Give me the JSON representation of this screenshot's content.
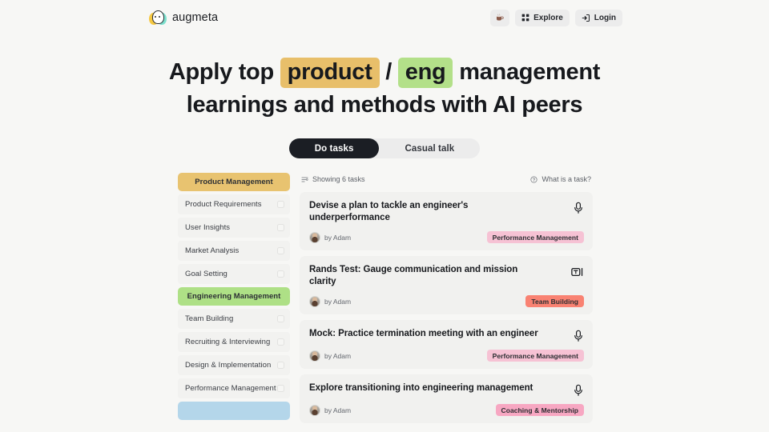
{
  "brand": {
    "name": "augmeta",
    "logo_icon": "augmeta-mascot-icon"
  },
  "topbar": {
    "coffee_button": {
      "icon": "coffee-cup-icon",
      "label": ""
    },
    "explore_button": {
      "icon": "grid-icon",
      "label": "Explore"
    },
    "login_button": {
      "icon": "login-arrow-icon",
      "label": "Login"
    }
  },
  "hero": {
    "line1_pre": "Apply top",
    "highlight_product": "product",
    "separator": "/",
    "highlight_eng": "eng",
    "line1_post": "management",
    "line2": "learnings and methods with AI peers",
    "product_color": "#e8bf6a",
    "eng_color": "#b3e089"
  },
  "mode_toggle": {
    "options": [
      "Do tasks",
      "Casual talk"
    ],
    "active": "Do tasks"
  },
  "sidebar": {
    "groups": [
      {
        "header": "Product Management",
        "color": "#e8c370",
        "items": [
          {
            "label": "Product Requirements",
            "checked": false
          },
          {
            "label": "User Insights",
            "checked": false
          },
          {
            "label": "Market Analysis",
            "checked": false
          },
          {
            "label": "Goal Setting",
            "checked": false
          }
        ]
      },
      {
        "header": "Engineering Management",
        "color": "#aee086",
        "items": [
          {
            "label": "Team Building",
            "checked": false
          },
          {
            "label": "Recruiting & Interviewing",
            "checked": false
          },
          {
            "label": "Design & Implementation",
            "checked": false
          },
          {
            "label": "Performance Management",
            "checked": false
          }
        ]
      },
      {
        "header": "",
        "color": "#b4d6ea",
        "items": []
      }
    ]
  },
  "task_list": {
    "count_label": "Showing 6 tasks",
    "count_icon": "filter-list-icon",
    "help_label": "What is a task?",
    "help_icon": "question-circle-icon",
    "tasks": [
      {
        "title": "Devise a plan to tackle an engineer's underperformance",
        "mode_icon": "microphone-icon",
        "author": "by Adam",
        "tag": "Performance Management",
        "tag_color": "#f6c2d4"
      },
      {
        "title": "Rands Test: Gauge communication and mission clarity",
        "mode_icon": "text-chat-icon",
        "author": "by Adam",
        "tag": "Team Building",
        "tag_color": "#f98272"
      },
      {
        "title": "Mock: Practice termination meeting with an engineer",
        "mode_icon": "microphone-icon",
        "author": "by Adam",
        "tag": "Performance Management",
        "tag_color": "#f6c2d4"
      },
      {
        "title": "Explore transitioning into engineering management",
        "mode_icon": "microphone-icon",
        "author": "by Adam",
        "tag": "Coaching & Mentorship",
        "tag_color": "#f7a7c2"
      }
    ]
  }
}
